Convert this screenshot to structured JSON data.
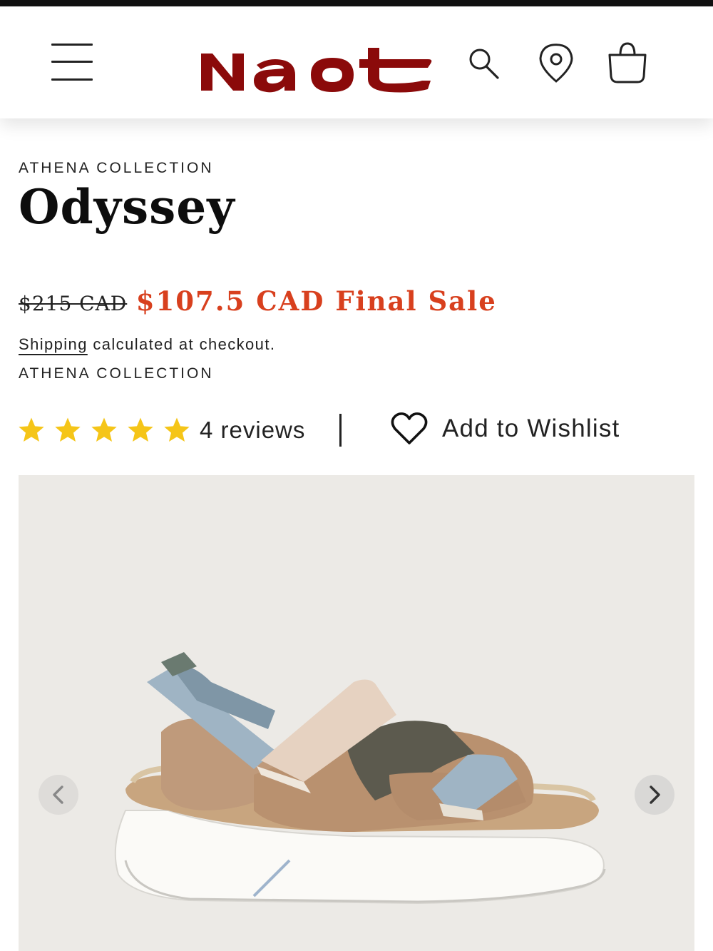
{
  "header": {
    "brand": "Naot",
    "brand_color": "#8b0a0a",
    "icons": [
      "menu-icon",
      "search-icon",
      "location-pin-icon",
      "shopping-bag-icon"
    ]
  },
  "product": {
    "collection": "ATHENA COLLECTION",
    "name": "Odyssey",
    "price_original": "$215 CAD",
    "price_sale": "$107.5 CAD Final Sale",
    "shipping_link": "Shipping",
    "shipping_text": " calculated at checkout.",
    "collection_repeat": "ATHENA COLLECTION",
    "rating": 5,
    "reviews": "4 reviews",
    "wishlist": "Add to Wishlist"
  },
  "colors": {
    "sale": "#d8401e",
    "star": "#f5c518",
    "gallery_bg": "#eceae6"
  },
  "gallery": {
    "icons": [
      "chevron-left-icon",
      "chevron-right-icon"
    ]
  }
}
